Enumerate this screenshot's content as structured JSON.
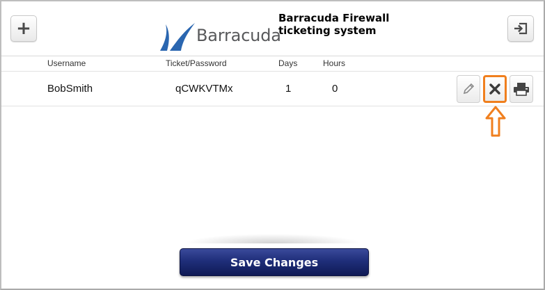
{
  "header": {
    "add_icon": "plus-icon",
    "logout_icon": "logout-icon",
    "logo_text": "Barracuda",
    "title": "Barracuda Firewall ticketing system"
  },
  "table": {
    "columns": [
      "Username",
      "Ticket/Password",
      "Days",
      "Hours"
    ],
    "rows": [
      {
        "username": "BobSmith",
        "ticket": "qCWKVTMx",
        "days": "1",
        "hours": "0"
      }
    ],
    "row_actions": [
      "pencil-icon",
      "close-icon",
      "printer-icon"
    ]
  },
  "footer": {
    "save_label": "Save Changes"
  },
  "colors": {
    "highlight": "#f07f1e",
    "logo_blue": "#2a66b0",
    "save_button": "#1f2e7a"
  }
}
